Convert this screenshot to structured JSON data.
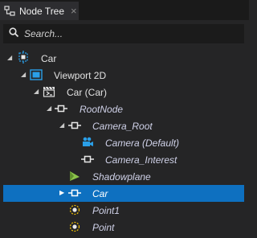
{
  "tab": {
    "title": "Node Tree",
    "close": "×"
  },
  "search": {
    "placeholder": "Search..."
  },
  "tree": {
    "car": "Car",
    "viewport": "Viewport 2D",
    "car_instance": "Car (Car)",
    "rootnode": "RootNode",
    "camera_root": "Camera_Root",
    "camera_default": "Camera (Default)",
    "camera_interest": "Camera_Interest",
    "shadowplane": "Shadowplane",
    "car_child": "Car",
    "point1": "Point1",
    "point": "Point"
  },
  "colors": {
    "selection": "#0e70c0",
    "icon_blue": "#2a9fe8",
    "icon_yellow": "#f2c000",
    "icon_green": "#8bc34a"
  }
}
